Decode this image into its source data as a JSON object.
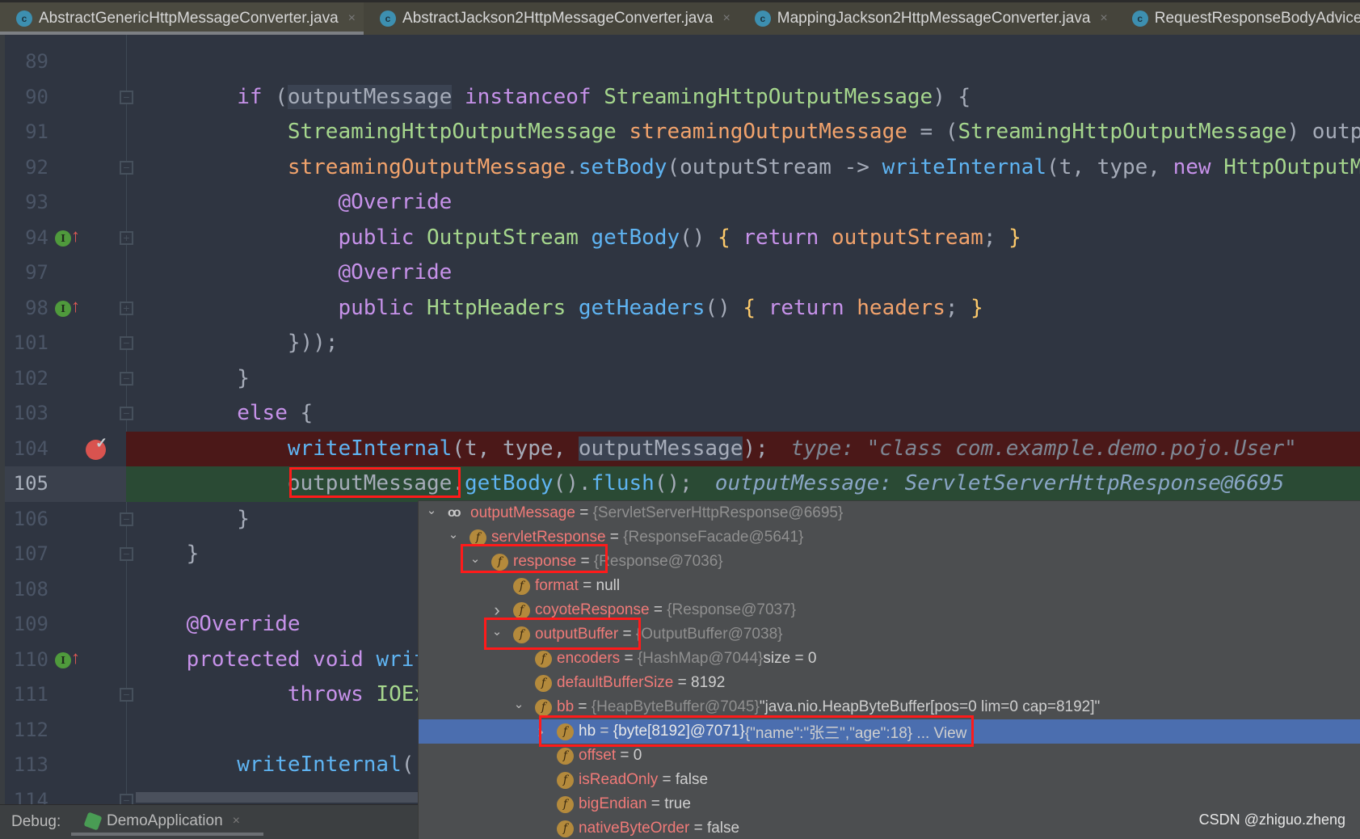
{
  "tabs": [
    {
      "label": "AbstractGenericHttpMessageConverter.java",
      "active": true,
      "icon": "class-icon"
    },
    {
      "label": "AbstractJackson2HttpMessageConverter.java",
      "active": false,
      "icon": "class-icon"
    },
    {
      "label": "MappingJackson2HttpMessageConverter.java",
      "active": false,
      "icon": "class-icon"
    },
    {
      "label": "RequestResponseBodyAdvice",
      "active": false,
      "icon": "class-icon"
    }
  ],
  "tab_close": "×",
  "code_lines": [
    {
      "n": "89",
      "t": []
    },
    {
      "n": "90",
      "fold": "−",
      "t": [
        [
          "        ",
          ""
        ],
        [
          "if",
          "kw"
        ],
        [
          " (",
          ""
        ],
        [
          "outputMessage",
          "hl"
        ],
        [
          " ",
          ""
        ],
        [
          "instanceof",
          "kw"
        ],
        [
          " ",
          ""
        ],
        [
          "StreamingHttpOutputMessage",
          "ty"
        ],
        [
          ") {",
          ""
        ]
      ]
    },
    {
      "n": "91",
      "t": [
        [
          "            ",
          ""
        ],
        [
          "StreamingHttpOutputMessage",
          "ty"
        ],
        [
          " ",
          ""
        ],
        [
          "streamingOutputMessage",
          "va"
        ],
        [
          " = (",
          ""
        ],
        [
          "StreamingHttpOutputMessage",
          "ty"
        ],
        [
          ") outputMessage;",
          ""
        ]
      ]
    },
    {
      "n": "92",
      "fold": "−",
      "t": [
        [
          "            ",
          ""
        ],
        [
          "streamingOutputMessage",
          "va"
        ],
        [
          ".",
          ""
        ],
        [
          "setBody",
          "fn"
        ],
        [
          "(outputStream -> ",
          ""
        ],
        [
          "writeInternal",
          "fn"
        ],
        [
          "(t, type, ",
          ""
        ],
        [
          "new",
          "kw"
        ],
        [
          " ",
          ""
        ],
        [
          "HttpOutputMessage",
          "ty"
        ],
        [
          "() {",
          ""
        ]
      ]
    },
    {
      "n": "93",
      "t": [
        [
          "                ",
          ""
        ],
        [
          "@Override",
          "kw"
        ]
      ]
    },
    {
      "n": "94",
      "impl": true,
      "fold": "+",
      "t": [
        [
          "                ",
          ""
        ],
        [
          "public",
          "kw"
        ],
        [
          " ",
          ""
        ],
        [
          "OutputStream",
          "ty"
        ],
        [
          " ",
          ""
        ],
        [
          "getBody",
          "fn"
        ],
        [
          "() ",
          ""
        ],
        [
          "{",
          "br"
        ],
        [
          " ",
          ""
        ],
        [
          "return",
          "kw"
        ],
        [
          " ",
          ""
        ],
        [
          "outputStream",
          "va"
        ],
        [
          "; ",
          ""
        ],
        [
          "}",
          "br"
        ]
      ]
    },
    {
      "n": "97",
      "t": [
        [
          "                ",
          ""
        ],
        [
          "@Override",
          "kw"
        ]
      ]
    },
    {
      "n": "98",
      "impl": true,
      "fold": "+",
      "t": [
        [
          "                ",
          ""
        ],
        [
          "public",
          "kw"
        ],
        [
          " ",
          ""
        ],
        [
          "HttpHeaders",
          "ty"
        ],
        [
          " ",
          ""
        ],
        [
          "getHeaders",
          "fn"
        ],
        [
          "() ",
          ""
        ],
        [
          "{",
          "br"
        ],
        [
          " ",
          ""
        ],
        [
          "return",
          "kw"
        ],
        [
          " ",
          ""
        ],
        [
          "headers",
          "va"
        ],
        [
          "; ",
          ""
        ],
        [
          "}",
          "br"
        ]
      ]
    },
    {
      "n": "101",
      "fold": "−",
      "t": [
        [
          "            }));",
          ""
        ]
      ]
    },
    {
      "n": "102",
      "fold": "−",
      "t": [
        [
          "        }",
          ""
        ]
      ]
    },
    {
      "n": "103",
      "fold": "−",
      "t": [
        [
          "        ",
          ""
        ],
        [
          "else",
          "kw"
        ],
        [
          " {",
          ""
        ]
      ]
    },
    {
      "n": "104",
      "state": "red",
      "breakpoint": true,
      "t": [
        [
          "            ",
          ""
        ],
        [
          "writeInternal",
          "fn"
        ],
        [
          "(t, type, ",
          ""
        ],
        [
          "outputMessage",
          "hl"
        ],
        [
          ");",
          ""
        ]
      ],
      "hint": "type: \"class com.example.demo.pojo.User\""
    },
    {
      "n": "105",
      "state": "green",
      "t": [
        [
          "            ",
          ""
        ],
        [
          "outputMessage",
          ""
        ],
        [
          ".",
          ""
        ],
        [
          "getBody",
          "fn"
        ],
        [
          "().",
          ""
        ],
        [
          "flush",
          "fn"
        ],
        [
          "();",
          ""
        ]
      ],
      "hint": "outputMessage: ServletServerHttpResponse@6695"
    },
    {
      "n": "106",
      "fold": "−",
      "t": [
        [
          "        }",
          ""
        ]
      ]
    },
    {
      "n": "107",
      "fold": "−",
      "t": [
        [
          "    }",
          ""
        ]
      ]
    },
    {
      "n": "108",
      "t": []
    },
    {
      "n": "109",
      "t": [
        [
          "    ",
          ""
        ],
        [
          "@Override",
          "kw"
        ]
      ]
    },
    {
      "n": "110",
      "impl": true,
      "t": [
        [
          "    ",
          ""
        ],
        [
          "protected",
          "kw"
        ],
        [
          " ",
          ""
        ],
        [
          "void",
          "kw"
        ],
        [
          " ",
          ""
        ],
        [
          "writeInternal",
          "fn"
        ],
        [
          "(",
          ""
        ]
      ]
    },
    {
      "n": "111",
      "fold": "−",
      "t": [
        [
          "            ",
          ""
        ],
        [
          "throws",
          "kw"
        ],
        [
          " ",
          ""
        ],
        [
          "IOException",
          "ty"
        ]
      ]
    },
    {
      "n": "112",
      "t": []
    },
    {
      "n": "113",
      "t": [
        [
          "        ",
          ""
        ],
        [
          "writeInternal",
          "fn"
        ],
        [
          "(",
          ""
        ]
      ]
    },
    {
      "n": "114",
      "fold": "−",
      "t": []
    }
  ],
  "debug_tree": [
    {
      "level": 0,
      "chev": "down",
      "icon": "watch",
      "name": "outputMessage",
      "ref": "{ServletServerHttpResponse@6695}",
      "extra": ""
    },
    {
      "level": 1,
      "chev": "down",
      "icon": "field",
      "name": "servletResponse",
      "ref": "{ResponseFacade@5641}",
      "extra": ""
    },
    {
      "level": 2,
      "chev": "down",
      "icon": "field",
      "name": "response",
      "ref": "{Response@7036}",
      "extra": ""
    },
    {
      "level": 3,
      "chev": "",
      "icon": "field",
      "name": "format",
      "ref": "",
      "extra": "null"
    },
    {
      "level": 3,
      "chev": "right",
      "icon": "field",
      "name": "coyoteResponse",
      "ref": "{Response@7037}",
      "extra": ""
    },
    {
      "level": 3,
      "chev": "down",
      "icon": "field",
      "name": "outputBuffer",
      "ref": "{OutputBuffer@7038}",
      "extra": ""
    },
    {
      "level": 4,
      "chev": "",
      "icon": "field",
      "name": "encoders",
      "ref": "{HashMap@7044}",
      "extra": " size = 0"
    },
    {
      "level": 4,
      "chev": "",
      "icon": "field",
      "name": "defaultBufferSize",
      "ref": "",
      "extra": "8192"
    },
    {
      "level": 4,
      "chev": "down",
      "icon": "field",
      "name": "bb",
      "ref": "{HeapByteBuffer@7045}",
      "extra": " \"java.nio.HeapByteBuffer[pos=0 lim=0 cap=8192]\""
    },
    {
      "level": 5,
      "chev": "right",
      "icon": "field",
      "name": "hb",
      "ref": "{byte[8192]@7071}",
      "extra": " {\"name\":\"张三\",\"age\":18} ... View",
      "selected": true
    },
    {
      "level": 5,
      "chev": "",
      "icon": "field",
      "name": "offset",
      "ref": "",
      "extra": "0"
    },
    {
      "level": 5,
      "chev": "",
      "icon": "field",
      "name": "isReadOnly",
      "ref": "",
      "extra": "false"
    },
    {
      "level": 5,
      "chev": "",
      "icon": "field",
      "name": "bigEndian",
      "ref": "",
      "extra": "true"
    },
    {
      "level": 5,
      "chev": "",
      "icon": "field",
      "name": "nativeByteOrder",
      "ref": "",
      "extra": "false"
    }
  ],
  "debug_bar": {
    "label": "Debug:",
    "session": "DemoApplication",
    "close": "×"
  },
  "watermark": "CSDN @zhiguo.zheng",
  "colors": {
    "breakpoint_line": "#4b1818",
    "execution_line": "#2a4a34",
    "selection": "#4b6eaf",
    "annotation_box": "#ff1a1a"
  }
}
